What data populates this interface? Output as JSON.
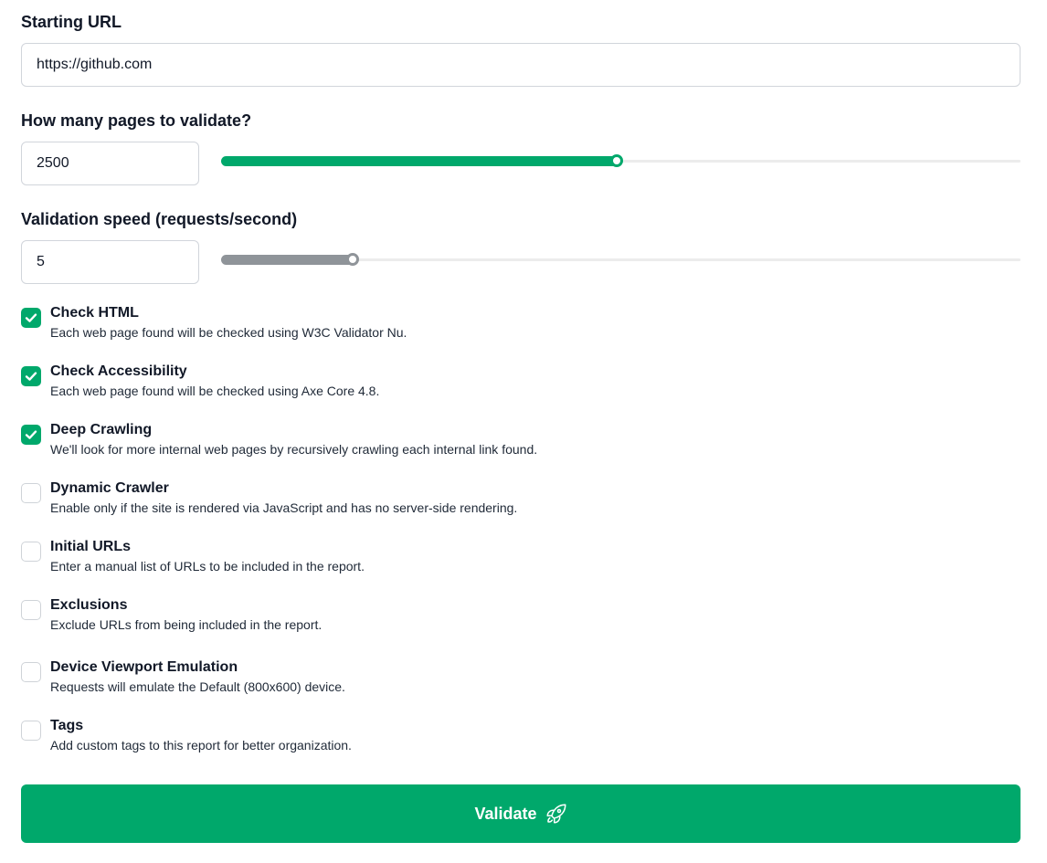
{
  "starting_url": {
    "label": "Starting URL",
    "value": "https://github.com"
  },
  "pages": {
    "label": "How many pages to validate?",
    "value": "2500",
    "slider_fraction": 0.5
  },
  "speed": {
    "label": "Validation speed (requests/second)",
    "value": "5",
    "slider_fraction": 0.17
  },
  "options": [
    {
      "title": "Check HTML",
      "description": "Each web page found will be checked using W3C Validator Nu.",
      "checked": true
    },
    {
      "title": "Check Accessibility",
      "description": "Each web page found will be checked using Axe Core 4.8.",
      "checked": true
    },
    {
      "title": "Deep Crawling",
      "description": "We'll look for more internal web pages by recursively crawling each internal link found.",
      "checked": true
    },
    {
      "title": "Dynamic Crawler",
      "description": "Enable only if the site is rendered via JavaScript and has no server-side rendering.",
      "checked": false
    },
    {
      "title": "Initial URLs",
      "description": "Enter a manual list of URLs to be included in the report.",
      "checked": false
    },
    {
      "title": "Exclusions",
      "description": "Exclude URLs from being included in the report.",
      "checked": false
    },
    {
      "title": "Device Viewport Emulation",
      "description": "Requests will emulate the Default (800x600) device.",
      "checked": false
    },
    {
      "title": "Tags",
      "description": "Add custom tags to this report for better organization.",
      "checked": false
    }
  ],
  "validate_button": {
    "label": "Validate",
    "icon": "rocket-icon"
  },
  "colors": {
    "accent": "#00a86b",
    "slider_gray": "#8f9499"
  }
}
